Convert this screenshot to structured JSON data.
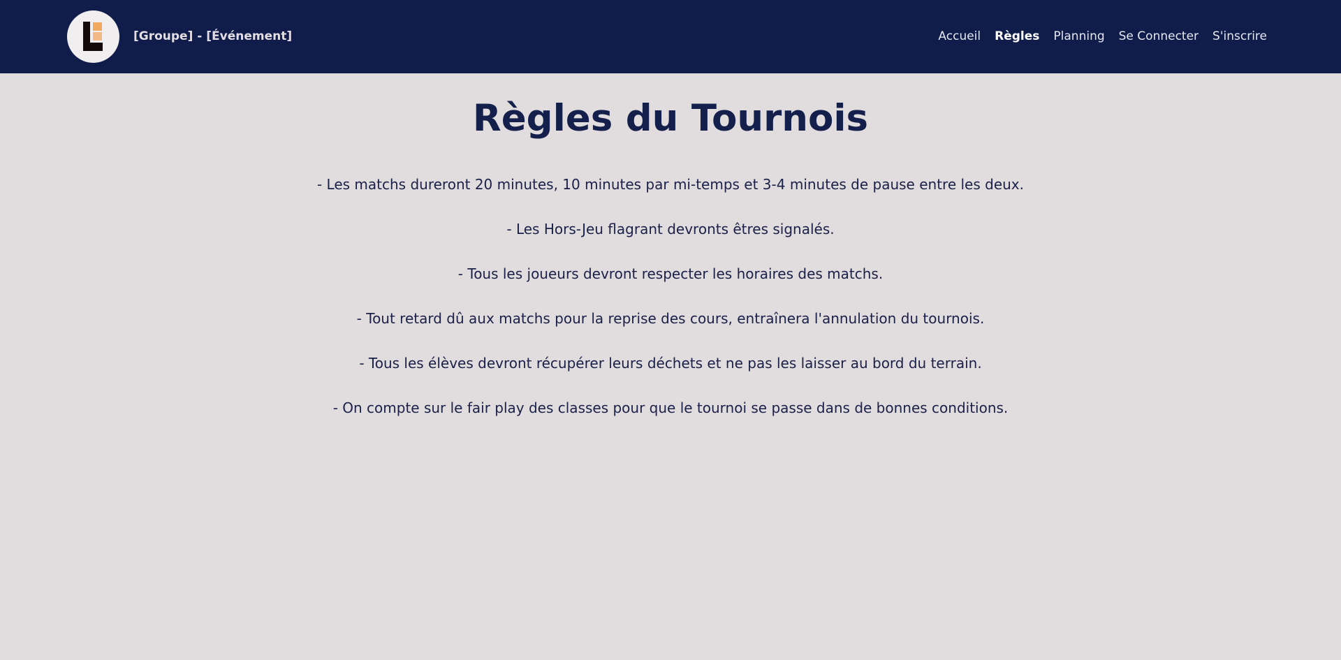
{
  "header": {
    "site_title": "[Groupe] - [Événement]",
    "logo_icon": "letter-l-logo-icon",
    "background_color": "#101c4a"
  },
  "nav": {
    "items": [
      {
        "label": "Accueil",
        "active": false
      },
      {
        "label": "Règles",
        "active": true
      },
      {
        "label": "Planning",
        "active": false
      },
      {
        "label": "Se Connecter",
        "active": false
      },
      {
        "label": "S'inscrire",
        "active": false
      }
    ]
  },
  "main": {
    "title": "Règles du Tournois",
    "rules": [
      "- Les matchs dureront 20 minutes, 10 minutes par mi-temps et 3-4 minutes de pause entre les deux.",
      "- Les Hors-Jeu flagrant devronts êtres signalés.",
      "- Tous les joueurs devront respecter les horaires des matchs.",
      "- Tout retard dû aux matchs pour la reprise des cours, entraînera l'annulation du tournois.",
      "- Tous les élèves devront récupérer leurs déchets et ne pas les laisser au bord du terrain.",
      "- On compte sur le fair play des classes pour que le tournoi se passe dans de bonnes conditions."
    ]
  },
  "colors": {
    "page_background": "#e1dcde",
    "title_color": "#14204b",
    "text_color": "#1a2048",
    "logo_accent": "#f0a95e"
  }
}
